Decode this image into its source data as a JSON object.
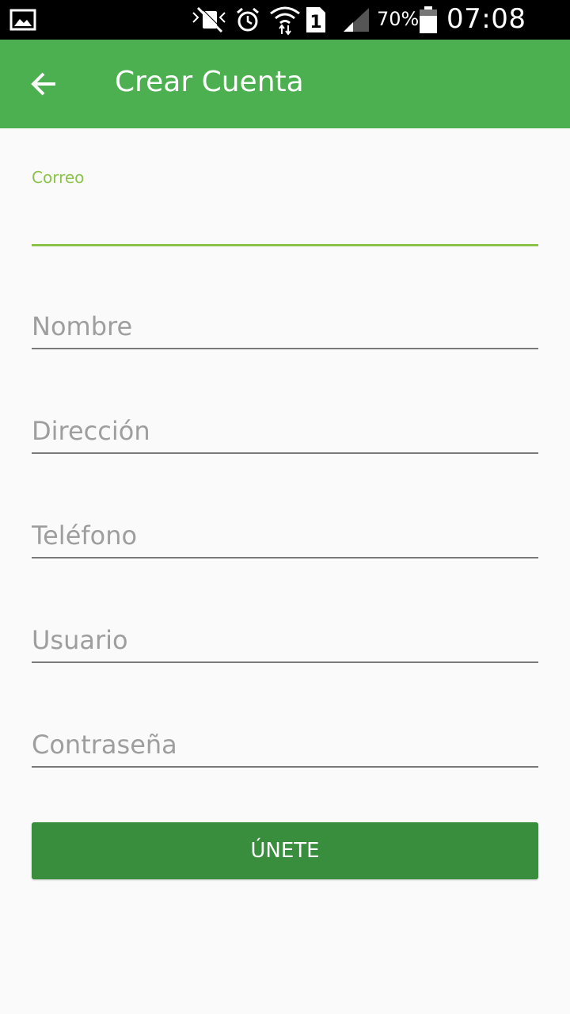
{
  "status_bar": {
    "battery_percent": "70%",
    "time": "07:08 PM",
    "sim_slot": "1",
    "icons": [
      "image-icon",
      "mute-icon",
      "alarm-icon",
      "wifi-icon",
      "sim-icon",
      "signal-icon",
      "battery-icon"
    ]
  },
  "app_bar": {
    "title": "Crear Cuenta",
    "back_icon": "arrow-back-icon"
  },
  "form": {
    "email_label": "Correo",
    "email_value": "",
    "name_placeholder": "Nombre",
    "address_placeholder": "Dirección",
    "phone_placeholder": "Teléfono",
    "username_placeholder": "Usuario",
    "password_placeholder": "Contraseña",
    "submit_label": "ÚNETE"
  },
  "colors": {
    "app_bar": "#4caf50",
    "accent": "#8bc34a",
    "button": "#388e3c",
    "background": "#fafafa"
  }
}
